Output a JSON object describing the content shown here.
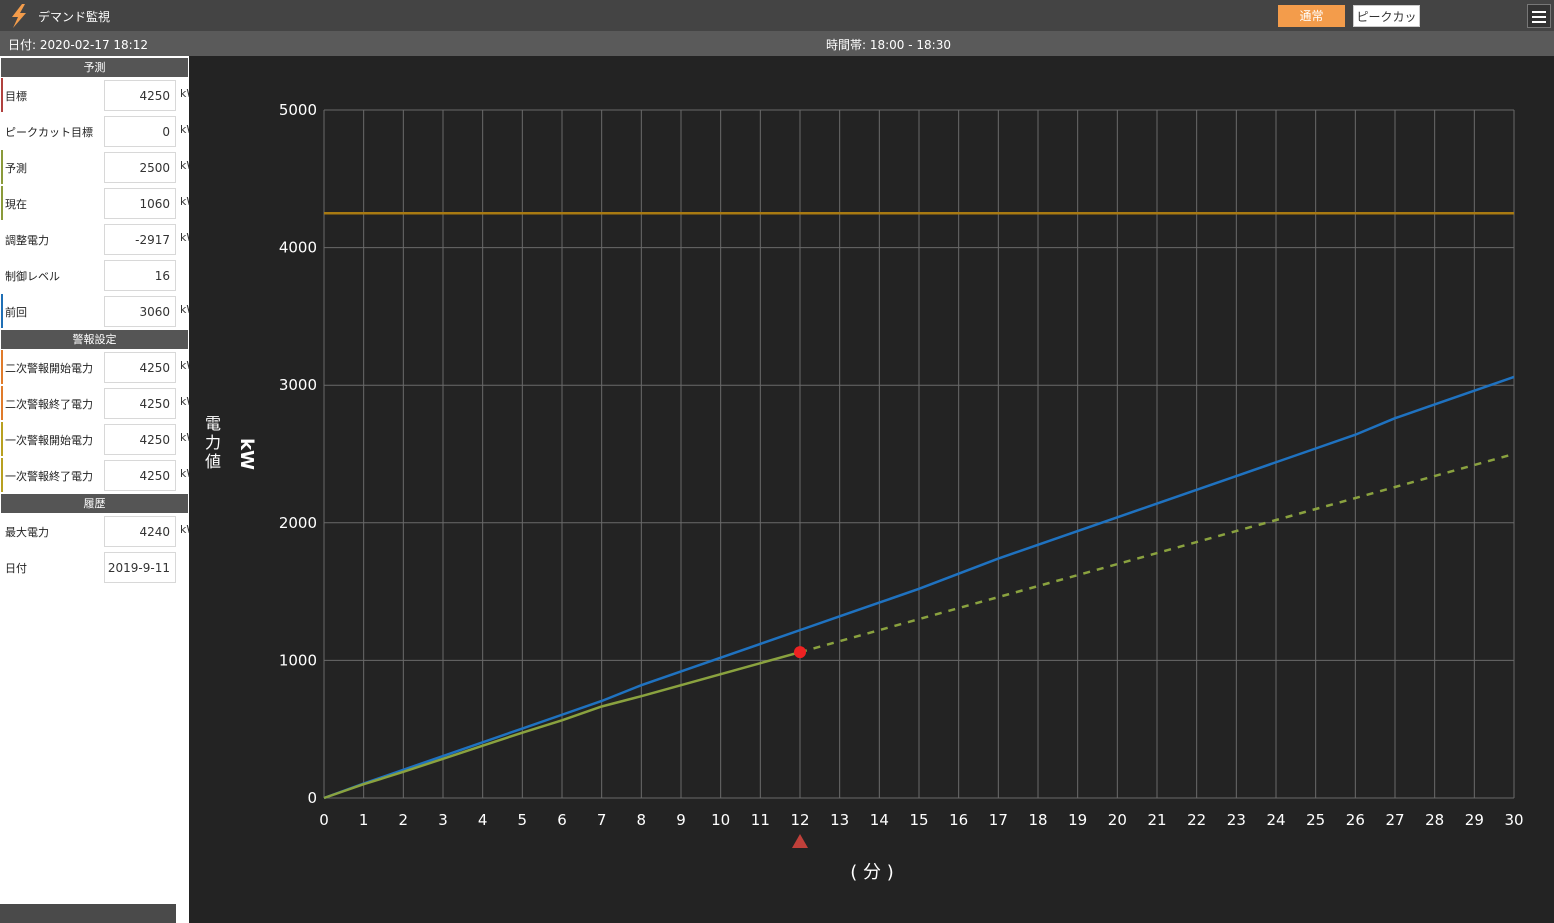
{
  "app": {
    "title": "デマンド監視"
  },
  "header": {
    "mode_normal": "通常",
    "mode_peakcut": "ピークカット"
  },
  "infobar": {
    "date": "日付: 2020-02-17 18:12",
    "time_slot": "時間帯: 18:00 - 18:30"
  },
  "sidebar": {
    "prediction_header": "予測",
    "alarm_header": "警報設定",
    "history_header": "履歴",
    "unit": "kW",
    "rows": [
      {
        "label": "目標",
        "value": "4250",
        "color": "#b0413e",
        "unit": true
      },
      {
        "label": "ピークカット目標",
        "value": "0",
        "color": "",
        "unit": true
      },
      {
        "label": "予測",
        "value": "2500",
        "color": "#8a9a3a",
        "unit": true
      },
      {
        "label": "現在",
        "value": "1060",
        "color": "#8a9a3a",
        "unit": true
      },
      {
        "label": "調整電力",
        "value": "-2917",
        "color": "",
        "unit": true
      },
      {
        "label": "制御レベル",
        "value": "16",
        "color": "",
        "unit": false
      },
      {
        "label": "前回",
        "value": "3060",
        "color": "#1f6fb5",
        "unit": true
      },
      {
        "label": "二次警報開始電力",
        "value": "4250",
        "color": "#e07b2a",
        "unit": true
      },
      {
        "label": "二次警報終了電力",
        "value": "4250",
        "color": "#e07b2a",
        "unit": true
      },
      {
        "label": "一次警報開始電力",
        "value": "4250",
        "color": "#b8a020",
        "unit": true
      },
      {
        "label": "一次警報終了電力",
        "value": "4250",
        "color": "#b8a020",
        "unit": true
      },
      {
        "label": "最大電力",
        "value": "4240",
        "color": "",
        "unit": true
      },
      {
        "label": "日付",
        "value": "2019-9-11",
        "color": "",
        "unit": false
      }
    ]
  },
  "chart_data": {
    "type": "line",
    "y_unit_label": "kW",
    "y_title": "電力値",
    "x_title": "( 分 )",
    "xlim": [
      0,
      30
    ],
    "ylim": [
      0,
      5000
    ],
    "y_ticks": [
      0,
      1000,
      2000,
      3000,
      4000,
      5000
    ],
    "x_ticks": [
      0,
      1,
      2,
      3,
      4,
      5,
      6,
      7,
      8,
      9,
      10,
      11,
      12,
      13,
      14,
      15,
      16,
      17,
      18,
      19,
      20,
      21,
      22,
      23,
      24,
      25,
      26,
      27,
      28,
      29,
      30
    ],
    "grid": true,
    "current_minute": 12,
    "target_line": {
      "value": 4250,
      "color": "#a87a12"
    },
    "series": [
      {
        "role": "previous",
        "color": "#1f72c0",
        "style": "solid",
        "x": [
          0,
          1,
          2,
          3,
          4,
          5,
          6,
          7,
          8,
          9,
          10,
          11,
          12,
          13,
          14,
          15,
          16,
          17,
          18,
          19,
          20,
          21,
          22,
          23,
          24,
          25,
          26,
          27,
          28,
          29,
          30
        ],
        "y": [
          0,
          105,
          205,
          305,
          405,
          505,
          605,
          705,
          820,
          920,
          1020,
          1120,
          1220,
          1320,
          1420,
          1520,
          1630,
          1740,
          1840,
          1940,
          2040,
          2140,
          2240,
          2340,
          2440,
          2540,
          2640,
          2760,
          2860,
          2960,
          3060
        ]
      },
      {
        "role": "current",
        "color": "#8aa23f",
        "style": "solid",
        "x": [
          0,
          1,
          2,
          3,
          4,
          5,
          6,
          7,
          8,
          9,
          10,
          11,
          12
        ],
        "y": [
          0,
          100,
          190,
          285,
          380,
          475,
          565,
          665,
          740,
          820,
          900,
          980,
          1060
        ]
      },
      {
        "role": "forecast",
        "color": "#8aa23f",
        "style": "dashed",
        "x": [
          12,
          30
        ],
        "y": [
          1060,
          2500
        ]
      }
    ],
    "current_point": {
      "x": 12,
      "y": 1060,
      "color": "#ee2222"
    }
  }
}
